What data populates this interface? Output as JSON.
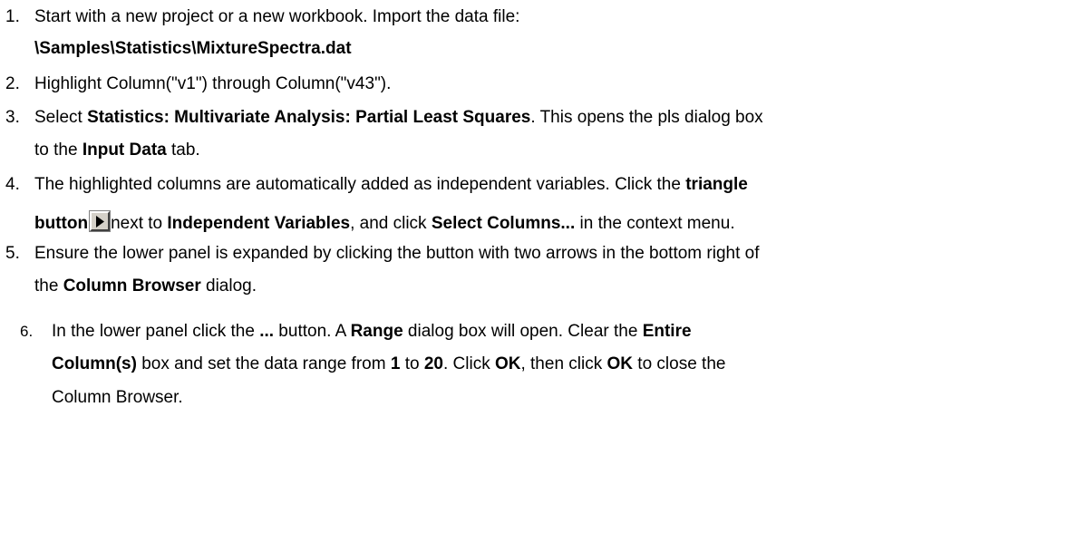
{
  "steps": [
    {
      "number": "1.",
      "lines": [
        [
          "Start with a new project or a new workbook. Import the data file:"
        ],
        [
          "\\Samples\\Statistics\\MixtureSpectra.dat"
        ]
      ]
    },
    {
      "number": "2.",
      "text": "Highlight Column(\"v1\") through Column(\"v43\")."
    },
    {
      "number": "3.",
      "parts": {
        "a": "Select ",
        "b": "Statistics: Multivariate Analysis: Partial Least Squares",
        "c": ". This opens the pls dialog box",
        "d": "to the ",
        "e": "Input Data",
        "f": " tab."
      }
    },
    {
      "number": "4.",
      "parts": {
        "a": "The highlighted columns are automatically added as independent variables. Click the ",
        "b": "triangle",
        "c": "button",
        "d": "next to ",
        "e": "Independent Variables",
        "f": ", and click ",
        "g": "Select Columns...",
        "h": " in the context menu."
      }
    },
    {
      "number": "5.",
      "parts": {
        "a": "Ensure the lower panel is expanded by clicking the button with two arrows in the bottom right of",
        "b": "the ",
        "c": "Column Browser",
        "d": " dialog."
      }
    },
    {
      "number": "6.",
      "parts": {
        "a": "In the lower panel click the ",
        "b": "...",
        "c": " button. A ",
        "d": "Range",
        "e": " dialog box will open. Clear the ",
        "f": "Entire",
        "g": "Column(s)",
        "h": " box and set the data range from ",
        "i": "1",
        "j": " to ",
        "k": "20",
        "l": ". Click ",
        "m": "OK",
        "n": ", then click ",
        "o": "OK",
        "p": " to close the",
        "q": "Column Browser."
      }
    }
  ],
  "icons": {
    "triangle_button": "play-triangle-icon"
  }
}
